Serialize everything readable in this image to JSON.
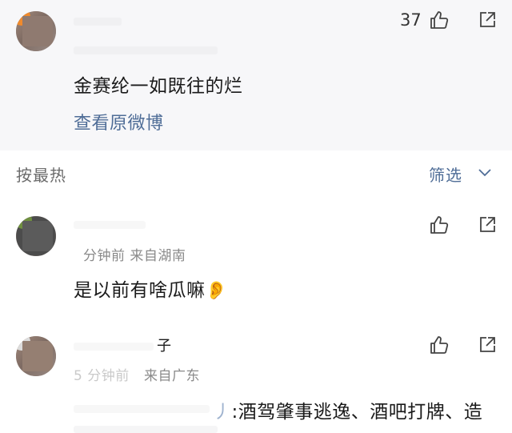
{
  "quoted_comment": {
    "likes": "37",
    "text": "金赛纶一如既往的烂",
    "view_original": "查看原微博"
  },
  "sort_bar": {
    "sort_label": "按最热",
    "filter_label": "筛选"
  },
  "comments": [
    {
      "meta": "分钟前   来自湖南",
      "text": "是以前有啥瓜嘛",
      "emoji": "👂"
    },
    {
      "name_fragment": "子",
      "meta_prefix": "5 分钟前",
      "meta": "来自广东",
      "text": ":酒驾肇事逃逸、酒吧打牌、造",
      "text_prefix": "丿"
    }
  ],
  "icons": {
    "like": "thumb-up-icon",
    "share": "share-icon",
    "filter_arrow": "chevron-down-icon"
  },
  "colors": {
    "link": "#4f6d97",
    "top_background": "#f7f7f9"
  }
}
